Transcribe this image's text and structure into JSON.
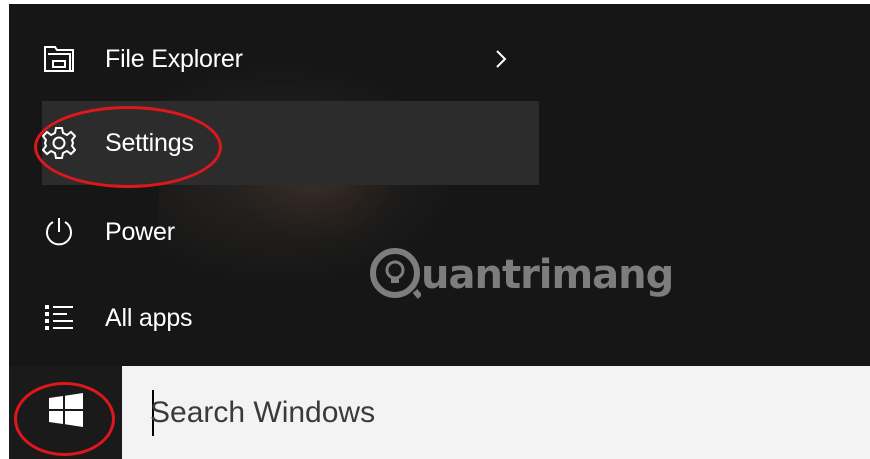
{
  "start_menu": {
    "items": [
      {
        "label": "File Explorer",
        "icon": "folder-explorer-icon",
        "has_submenu": true
      },
      {
        "label": "Settings",
        "icon": "gear-icon",
        "highlighted": true
      },
      {
        "label": "Power",
        "icon": "power-icon"
      },
      {
        "label": "All apps",
        "icon": "list-icon"
      }
    ]
  },
  "watermark": {
    "logo_icon": "lightbulb-icon",
    "text": "uantrimang"
  },
  "taskbar": {
    "start_icon": "windows-logo-icon",
    "search": {
      "placeholder": "Search Windows",
      "value": ""
    }
  },
  "colors": {
    "menu_background": "#161616",
    "menu_highlight": "#2c2c2c",
    "taskbar_background": "#f3f3f3",
    "annotation_red": "#e0161d"
  }
}
